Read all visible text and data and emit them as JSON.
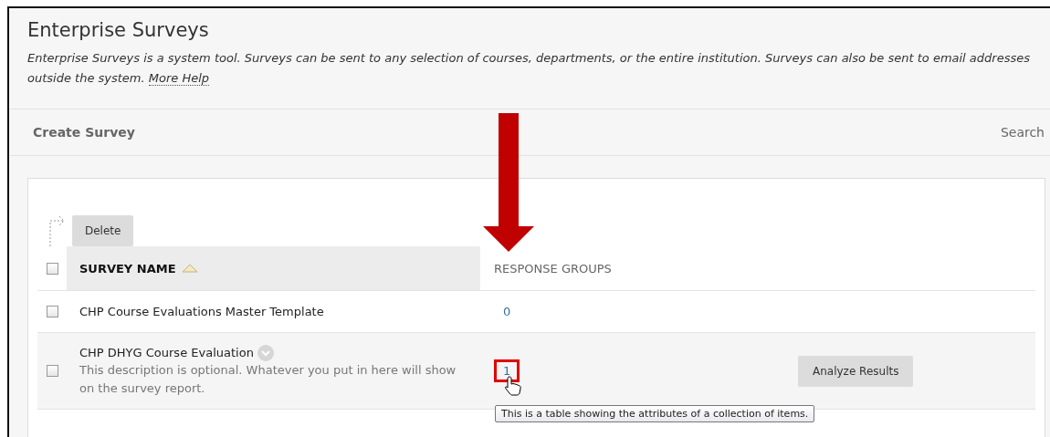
{
  "page": {
    "title": "Enterprise Surveys",
    "description": "Enterprise Surveys is a system tool. Surveys can be sent to any selection of courses, departments, or the entire institution. Surveys can also be sent to email addresses outside the system.",
    "help_link": "More Help"
  },
  "action_bar": {
    "create": "Create Survey",
    "search": "Search"
  },
  "table": {
    "delete_button": "Delete",
    "header_checked": false,
    "columns": [
      {
        "label": "SURVEY NAME",
        "sorted": true
      },
      {
        "label": "RESPONSE GROUPS",
        "sorted": false
      }
    ],
    "rows": [
      {
        "name": "CHP Course Evaluations Master Template",
        "checked": false,
        "responses": "0",
        "highlighted": false,
        "menu": false
      },
      {
        "name": "CHP DHYG Course Evaluation",
        "description": "This description is optional. Whatever you put in here will show on the survey report.",
        "checked": false,
        "responses": "1",
        "highlighted": true,
        "menu": true,
        "action": "Analyze Results"
      }
    ]
  },
  "tooltip": "This is a table showing the attributes of a collection of items."
}
